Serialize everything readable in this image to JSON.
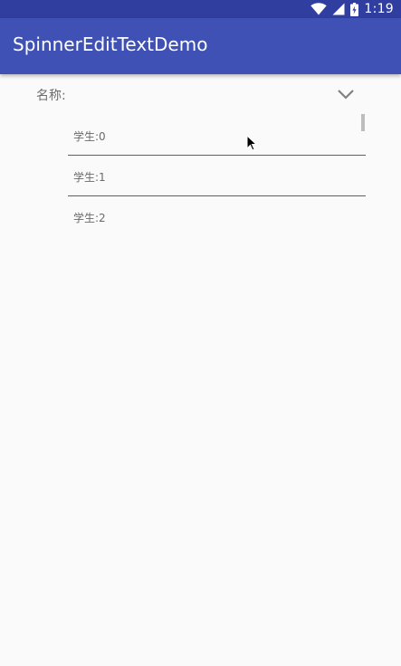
{
  "status_bar": {
    "time": "1:19",
    "icons": [
      "wifi-icon",
      "signal-icon",
      "battery-charging-icon"
    ]
  },
  "app_bar": {
    "title": "SpinnerEditTextDemo"
  },
  "form": {
    "label": "名称:",
    "dropdown_icon": "chevron-down-icon"
  },
  "dropdown": {
    "items": [
      {
        "label": "学生:0"
      },
      {
        "label": "学生:1"
      },
      {
        "label": "学生:2"
      }
    ]
  },
  "colors": {
    "status_bar": "#303f9f",
    "app_bar": "#3f51b5",
    "background": "#fafafa"
  }
}
